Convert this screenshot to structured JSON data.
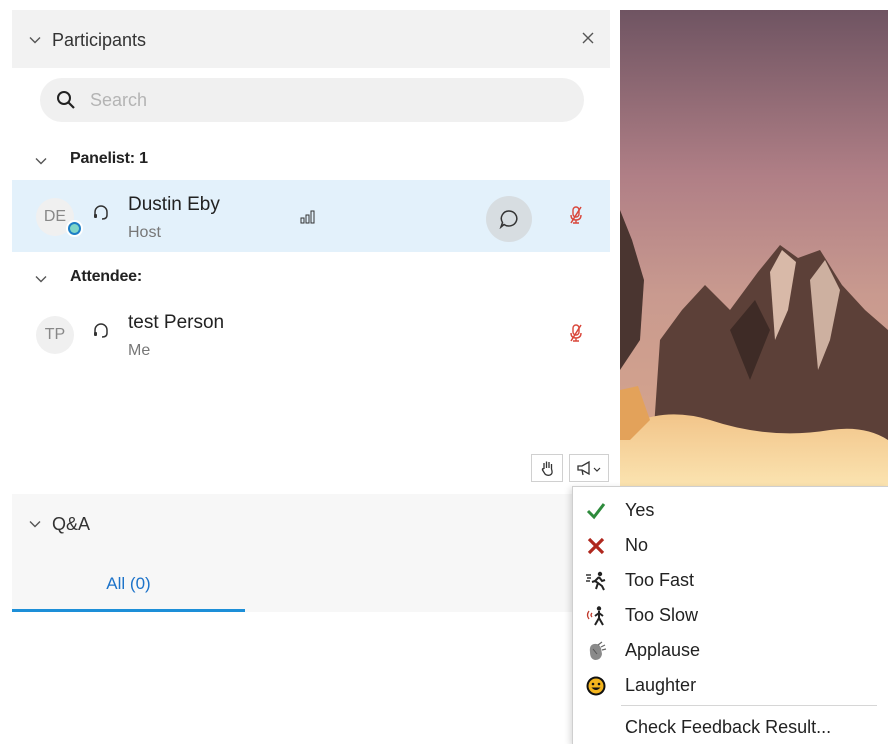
{
  "participants": {
    "title": "Participants",
    "search_placeholder": "Search",
    "groups": [
      {
        "label": "Panelist: 1",
        "members": [
          {
            "initials": "DE",
            "name": "Dustin Eby",
            "role": "Host"
          }
        ]
      },
      {
        "label": "Attendee:",
        "members": [
          {
            "initials": "TP",
            "name": "test Person",
            "role": "Me"
          }
        ]
      }
    ]
  },
  "qa": {
    "title": "Q&A",
    "tabs": [
      {
        "label": "All (0)",
        "active": true
      }
    ]
  },
  "feedback_menu": {
    "items": [
      {
        "label": "Yes",
        "icon": "checkmark-icon"
      },
      {
        "label": "No",
        "icon": "x-mark-icon"
      },
      {
        "label": "Too Fast",
        "icon": "running-person-icon"
      },
      {
        "label": "Too Slow",
        "icon": "walking-person-icon"
      },
      {
        "label": "Applause",
        "icon": "clapping-hands-icon"
      },
      {
        "label": "Laughter",
        "icon": "smiley-icon"
      }
    ],
    "footer_label": "Check Feedback Result..."
  },
  "colors": {
    "accent": "#1d73c9",
    "selected_row": "#e3f1fb",
    "muted_mic": "#d9463a",
    "checkmark": "#2e8b3c",
    "xmark": "#b0281e"
  }
}
